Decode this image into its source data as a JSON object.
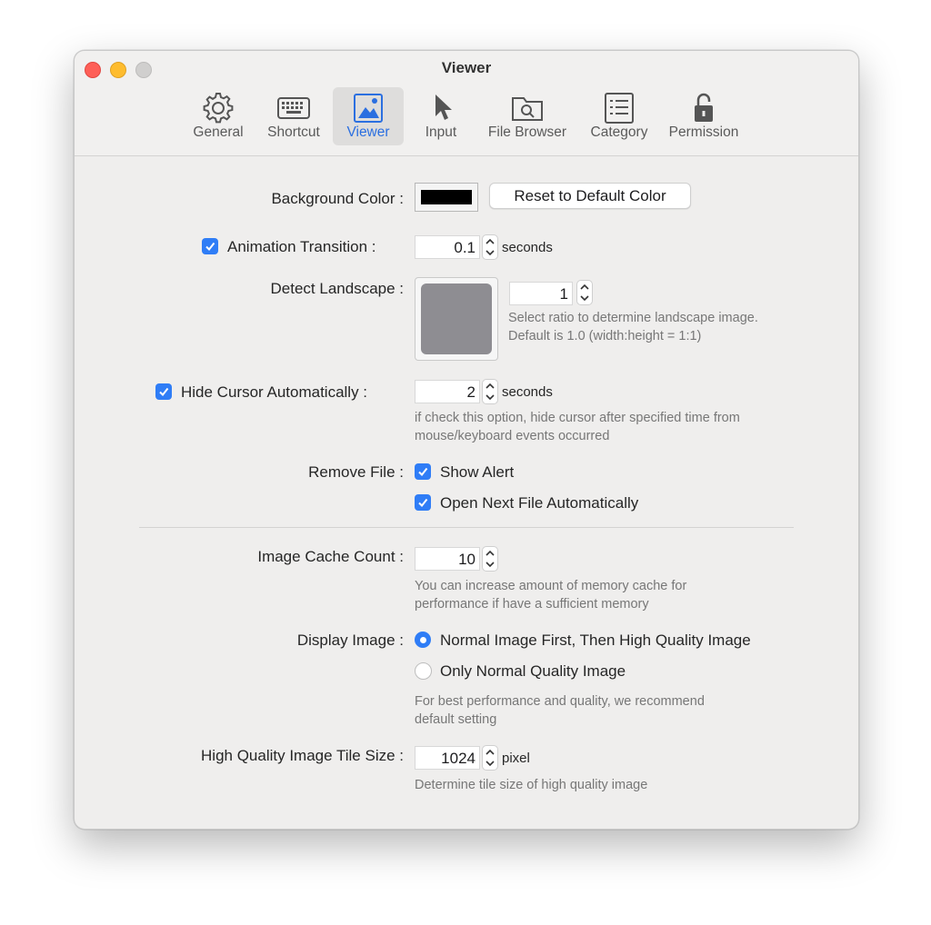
{
  "window": {
    "title": "Viewer"
  },
  "tabs": [
    {
      "label": "General",
      "icon": "gear-icon"
    },
    {
      "label": "Shortcut",
      "icon": "keyboard-icon"
    },
    {
      "label": "Viewer",
      "icon": "image-icon",
      "active": true
    },
    {
      "label": "Input",
      "icon": "cursor-arrow-icon"
    },
    {
      "label": "File Browser",
      "icon": "folder-search-icon"
    },
    {
      "label": "Category",
      "icon": "list-icon"
    },
    {
      "label": "Permission",
      "icon": "unlock-icon"
    }
  ],
  "settings": {
    "background_color": {
      "label": "Background Color :",
      "color": "#000000",
      "reset_label": "Reset to Default Color"
    },
    "animation": {
      "label": "Animation Transition :",
      "checked": true,
      "value": "0.1",
      "unit": "seconds"
    },
    "landscape": {
      "label": "Detect Landscape :",
      "value": "1",
      "hint1": "Select ratio to determine landscape image.",
      "hint2": "Default is 1.0 (width:height = 1:1)"
    },
    "hide_cursor": {
      "label": "Hide Cursor Automatically :",
      "checked": true,
      "value": "2",
      "unit": "seconds",
      "hint1": "if check this option, hide cursor after specified time from",
      "hint2": "mouse/keyboard events occurred"
    },
    "remove_file": {
      "label": "Remove File :",
      "show_alert": "Show Alert",
      "open_next": "Open Next File Automatically"
    },
    "cache": {
      "label": "Image Cache Count :",
      "value": "10",
      "hint1": "You can increase amount of memory cache for",
      "hint2": "performance if have a sufficient memory"
    },
    "display": {
      "label": "Display Image :",
      "option1": "Normal Image First, Then High Quality Image",
      "option2": "Only Normal Quality Image",
      "selected": "option1",
      "hint1": "For best performance and quality, we recommend",
      "hint2": "default setting"
    },
    "tile": {
      "label": "High Quality Image Tile Size :",
      "value": "1024",
      "unit": "pixel",
      "hint": "Determine tile size of high quality image"
    }
  },
  "colors": {
    "accent": "#2f7df6",
    "close": "#fe5f57",
    "minimize": "#febc2e",
    "zoom": "#d0cfce"
  }
}
